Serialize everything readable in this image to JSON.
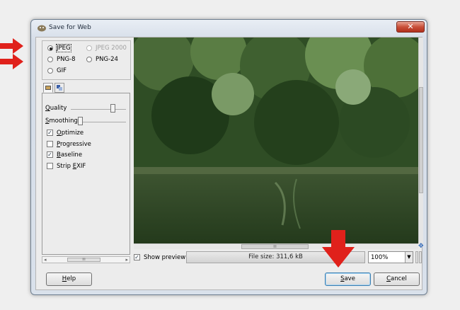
{
  "window": {
    "title": "Save for Web",
    "close_glyph": "✕"
  },
  "formats": {
    "jpeg": "JPEG",
    "jpeg2000": "JPEG 2000",
    "png8": "PNG-8",
    "png24": "PNG-24",
    "gif": "GIF",
    "selected": "JPEG"
  },
  "tabs": [
    {
      "icon": "image-settings-icon"
    },
    {
      "icon": "metadata-icon"
    }
  ],
  "options": {
    "quality_label": "Quality",
    "smoothing_label": "Smoothing",
    "checkboxes": [
      {
        "label": "Optimize",
        "checked": true
      },
      {
        "label": "Progressive",
        "checked": false
      },
      {
        "label": "Baseline",
        "checked": true
      },
      {
        "label": "Strip EXIF",
        "checked": false
      }
    ]
  },
  "scroll": {
    "thumb_text": "III"
  },
  "preview": {
    "show_preview_label": "Show preview",
    "show_preview_checked": true,
    "file_size": "File size: 311,6 kB",
    "zoom": "100%"
  },
  "buttons": {
    "help": "Help",
    "save": "Save",
    "cancel": "Cancel"
  },
  "annotations": {
    "arrow_color": "#e0211b"
  }
}
